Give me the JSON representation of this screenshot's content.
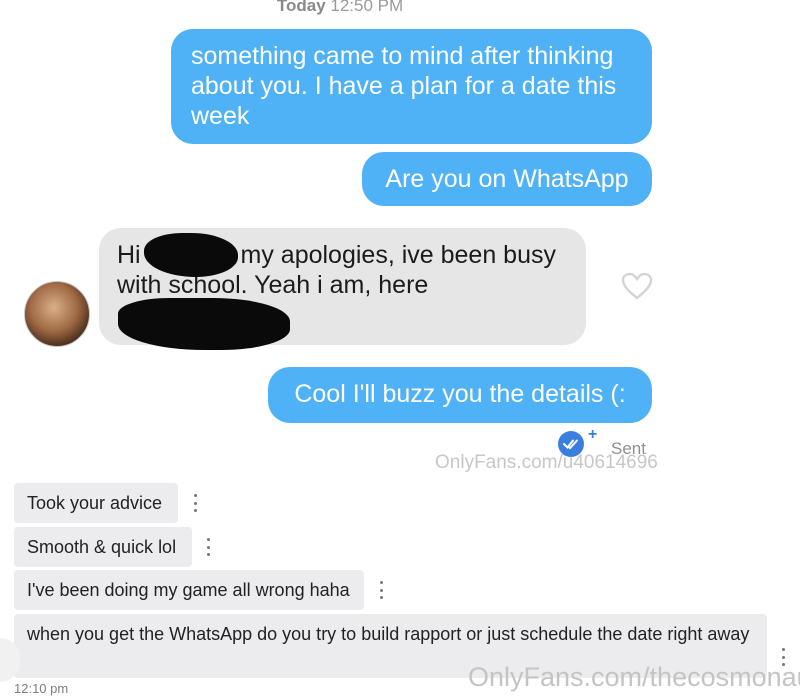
{
  "header": {
    "date_label": "Today",
    "time_label": "12:50 PM"
  },
  "conversation": {
    "outgoing_1": "something came to mind after thinking about you. I have a plan for a date this week",
    "outgoing_2": "Are you on WhatsApp",
    "incoming_line_1_start": "Hi",
    "incoming_line_1_end": "my apologies, ive been busy",
    "incoming_line_2": "with school. Yeah i am, here",
    "outgoing_3": "Cool I'll buzz you the details (:",
    "sent_status": "Sent",
    "watermark_small": "OnlyFans.com/u40614696"
  },
  "second_chat": {
    "messages": [
      "Took your advice",
      "Smooth & quick lol",
      "I've been doing my game all wrong haha",
      "when you get the WhatsApp do you try to build rapport or just schedule the date right away"
    ],
    "timestamp": "12:10 pm",
    "watermark_big": "OnlyFans.com/thecosmonaut"
  },
  "colors": {
    "outgoing_bubble": "#4fb2f6",
    "incoming_bubble": "#e6e6e7",
    "secondary_bubble": "#ececef",
    "sent_check": "#3a7fe0"
  },
  "icons": [
    "heart-icon",
    "double-check-icon",
    "plus-icon",
    "kebab-menu-icon"
  ]
}
